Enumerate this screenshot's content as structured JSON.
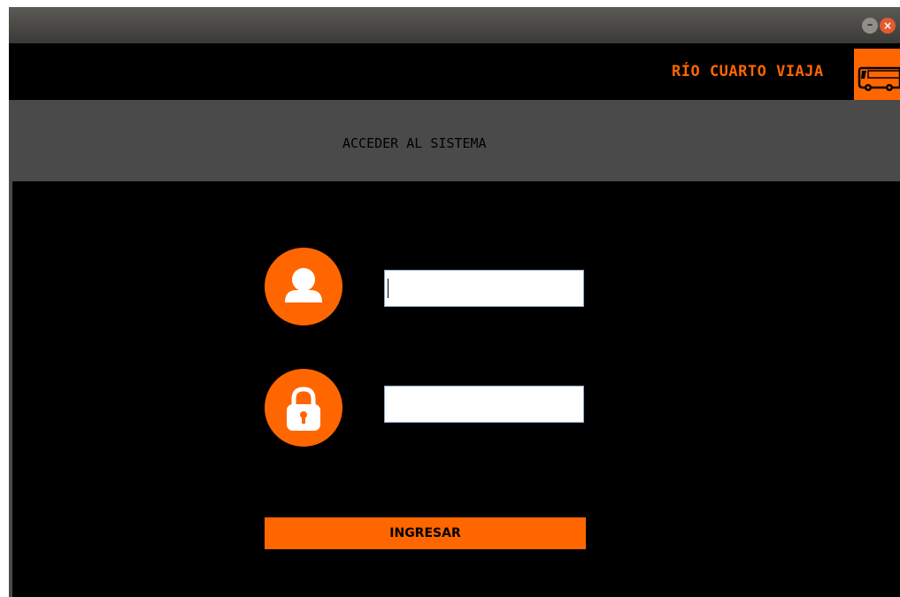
{
  "window": {
    "buttons": {
      "minimize_glyph": "–",
      "close_glyph": "×"
    }
  },
  "header": {
    "brand": "RÍO CUARTO VIAJA",
    "logo_icon": "bus-icon"
  },
  "subheader": {
    "title": "ACCEDER AL SISTEMA"
  },
  "form": {
    "username": {
      "icon": "user-icon",
      "value": ""
    },
    "password": {
      "icon": "lock-icon",
      "value": ""
    },
    "submit_label": "INGRESAR"
  },
  "colors": {
    "accent": "#ff6600",
    "background": "#000000",
    "band": "#4a4a4a"
  }
}
